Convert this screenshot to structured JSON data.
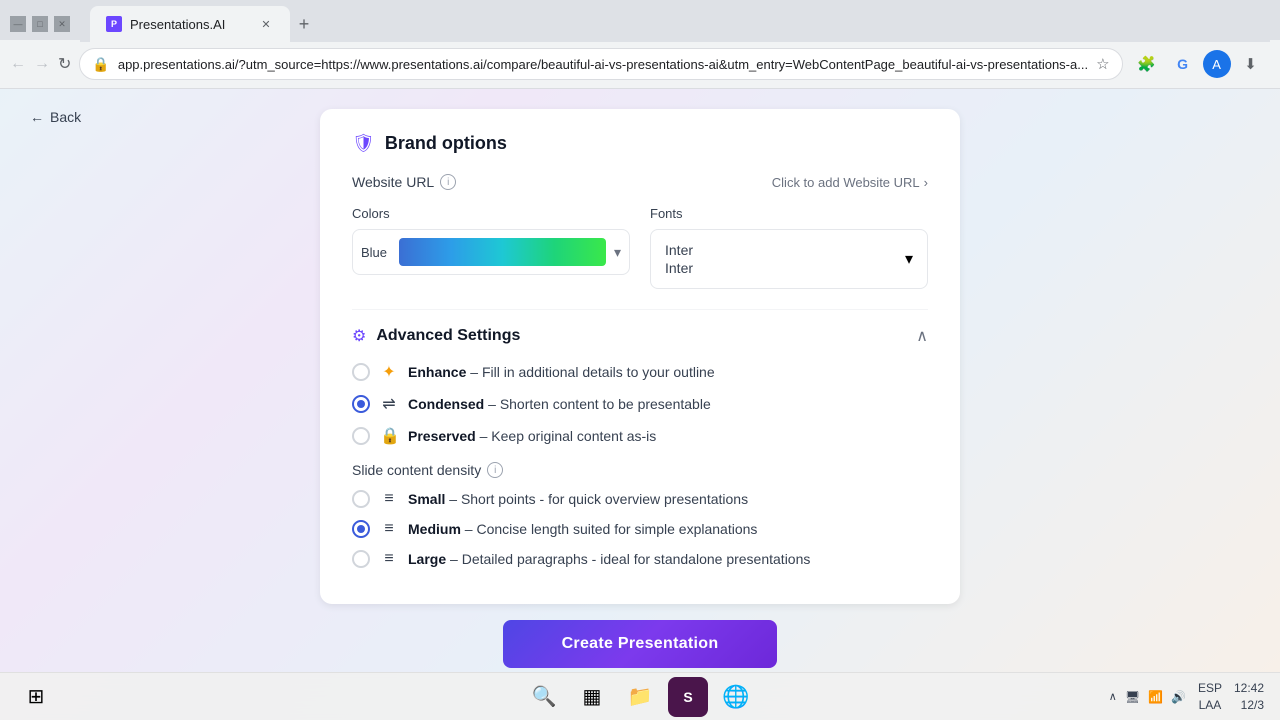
{
  "browser": {
    "tab_favicon": "P",
    "tab_label": "Presentations.AI",
    "address_url": "app.presentations.ai/?utm_source=https://www.presentations.ai/compare/beautiful-ai-vs-presentations-ai&utm_entry=WebContentPage_beautiful-ai-vs-presentations-a...",
    "new_tab_label": "+",
    "back_btn": "←",
    "forward_btn": "→",
    "refresh_btn": "↻",
    "home_btn": "⌂"
  },
  "page": {
    "back_label": "Back"
  },
  "card": {
    "title": "Brand options",
    "website_url_label": "Website URL",
    "click_to_add_label": "Click to add Website URL",
    "colors_label": "Colors",
    "color_swatch_label": "Blue",
    "fonts_label": "Fonts",
    "font_primary": "Inter",
    "font_secondary": "Inter",
    "advanced_title": "Advanced Settings",
    "enhance_label": "Enhance",
    "enhance_desc": "Fill in additional details to your outline",
    "condensed_label": "Condensed",
    "condensed_desc": "Shorten content to be presentable",
    "preserved_label": "Preserved",
    "preserved_desc": "Keep original content as-is",
    "slide_density_label": "Slide content density",
    "small_label": "Small",
    "small_desc": "Short points - for quick overview presentations",
    "medium_label": "Medium",
    "medium_desc": "Concise length suited for simple explanations",
    "large_label": "Large",
    "large_desc": "Detailed paragraphs - ideal for standalone presentations",
    "create_btn_label": "Create Presentation"
  },
  "taskbar": {
    "windows_icon": "⊞",
    "search_icon": "🔍",
    "widgets_icon": "▦",
    "files_icon": "📁",
    "slack_icon": "S",
    "chrome_icon": "⬤",
    "time": "12:42",
    "date": "12/3",
    "lang": "ESP\nLAA",
    "chevron": "∧"
  },
  "colors": {
    "brand_purple": "#6c47ff",
    "radio_blue": "#3b5bdb",
    "btn_gradient_start": "#4f46e5",
    "btn_gradient_end": "#7c3aed"
  }
}
